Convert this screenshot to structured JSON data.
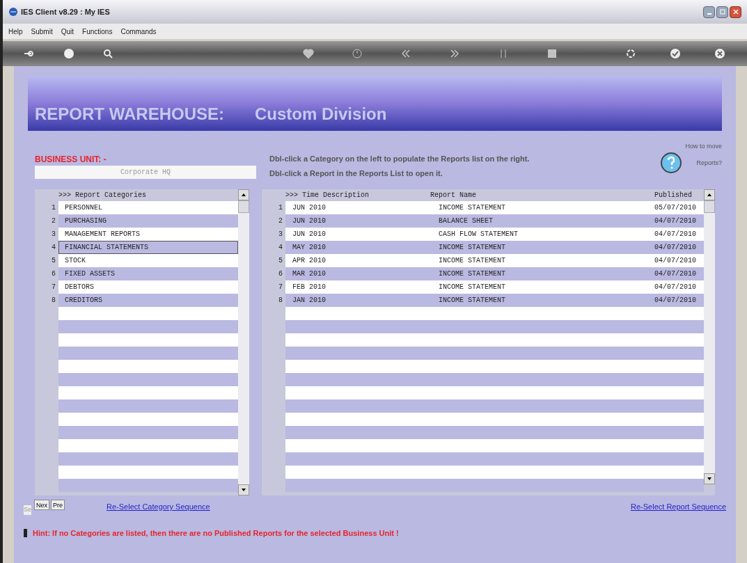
{
  "window": {
    "title": "IES Client v8.29 : My IES"
  },
  "menu": [
    "Help",
    "Submit",
    "Quit",
    "Functions",
    "Commands"
  ],
  "banner": {
    "title": "REPORT WAREHOUSE:",
    "subtitle": "Custom Division"
  },
  "business_unit": {
    "label": "BUSINESS UNIT: -",
    "value": "Corporate HQ"
  },
  "instructions": [
    "Dbl-click a Category on the left to populate the Reports list on the right.",
    "Dbl-click a Report in the Reports  List  to open it."
  ],
  "help": {
    "label_1": "How to move",
    "label_2": "Reports?"
  },
  "categories": {
    "header": ">>> Report Categories",
    "rows": [
      {
        "num": "1",
        "name": "PERSONNEL",
        "selected": false
      },
      {
        "num": "2",
        "name": "PURCHASING",
        "selected": false
      },
      {
        "num": "3",
        "name": "MANAGEMENT REPORTS",
        "selected": false
      },
      {
        "num": "4",
        "name": "FINANCIAL STATEMENTS",
        "selected": true
      },
      {
        "num": "5",
        "name": "STOCK",
        "selected": false
      },
      {
        "num": "6",
        "name": "FIXED ASSETS",
        "selected": false
      },
      {
        "num": "7",
        "name": "DEBTORS",
        "selected": false
      },
      {
        "num": "8",
        "name": "CREDITORS",
        "selected": false
      }
    ]
  },
  "reports": {
    "columns": [
      ">>> Time Description",
      "Report Name",
      "Published"
    ],
    "rows": [
      {
        "num": "1",
        "time": "JUN 2010",
        "name": "INCOME STATEMENT",
        "published": "05/07/2010"
      },
      {
        "num": "2",
        "time": "JUN 2010",
        "name": "BALANCE SHEET",
        "published": "04/07/2010"
      },
      {
        "num": "3",
        "time": "JUN 2010",
        "name": "CASH FLOW STATEMENT",
        "published": "04/07/2010"
      },
      {
        "num": "4",
        "time": "MAY 2010",
        "name": "INCOME STATEMENT",
        "published": "04/07/2010"
      },
      {
        "num": "5",
        "time": "APR 2010",
        "name": "INCOME STATEMENT",
        "published": "04/07/2010"
      },
      {
        "num": "6",
        "time": "MAR 2010",
        "name": "INCOME STATEMENT",
        "published": "04/07/2010"
      },
      {
        "num": "7",
        "time": "FEB 2010",
        "name": "INCOME STATEMENT",
        "published": "04/07/2010"
      },
      {
        "num": "8",
        "time": "JAN 2010",
        "name": "INCOME STATEMENT",
        "published": "04/07/2010"
      }
    ]
  },
  "nav_buttons": [
    "Nex",
    "Pre"
  ],
  "side_label": "Se",
  "links": {
    "category": "Re-Select Category Sequence",
    "report": "Re-Select Report Sequence"
  },
  "hint": "Hint: If no Categories are listed, then there are no Published Reports for  the selected Business Unit !"
}
